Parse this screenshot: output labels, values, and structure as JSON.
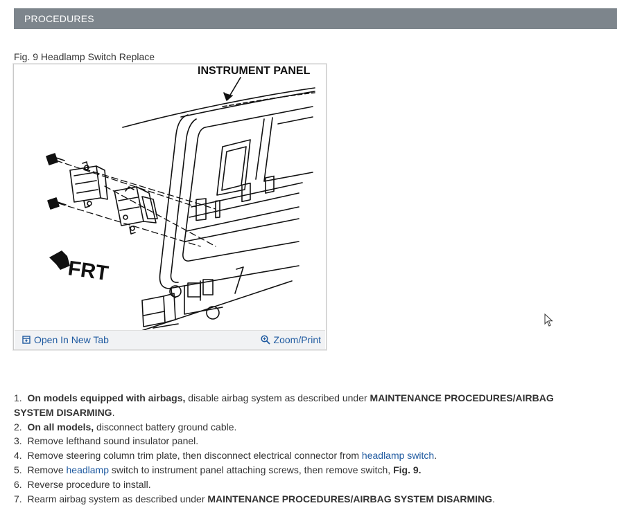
{
  "header": {
    "title": "PROCEDURES"
  },
  "figure": {
    "caption": "Fig. 9 Headlamp Switch Replace",
    "labels": {
      "instrument_panel": "INSTRUMENT PANEL",
      "front": "FRT"
    },
    "toolbar": {
      "open_new_tab": "Open In New Tab",
      "zoom_print": "Zoom/Print"
    }
  },
  "steps": [
    {
      "num": "1.",
      "bold_lead": "On models equipped with airbags,",
      "text": " disable airbag system as described under ",
      "bold_ref": "MAINTENANCE PROCEDURES/AIRBAG SYSTEM DISARMING",
      "end": "."
    },
    {
      "num": "2.",
      "bold_lead": "On all models,",
      "text": " disconnect battery ground cable."
    },
    {
      "num": "3.",
      "text": "Remove lefthand sound insulator panel."
    },
    {
      "num": "4.",
      "text": "Remove steering column trim plate, then disconnect electrical connector from ",
      "link": "headlamp switch",
      "end": "."
    },
    {
      "num": "5.",
      "text_before": "Remove ",
      "link": "headlamp",
      "text": " switch to instrument panel attaching screws, then remove switch, ",
      "bold_ref": "Fig. 9.",
      "end": ""
    },
    {
      "num": "6.",
      "text": "Reverse procedure to install."
    },
    {
      "num": "7.",
      "text": "Rearm airbag system as described under ",
      "bold_ref": "MAINTENANCE PROCEDURES/AIRBAG SYSTEM DISARMING",
      "end": "."
    }
  ]
}
